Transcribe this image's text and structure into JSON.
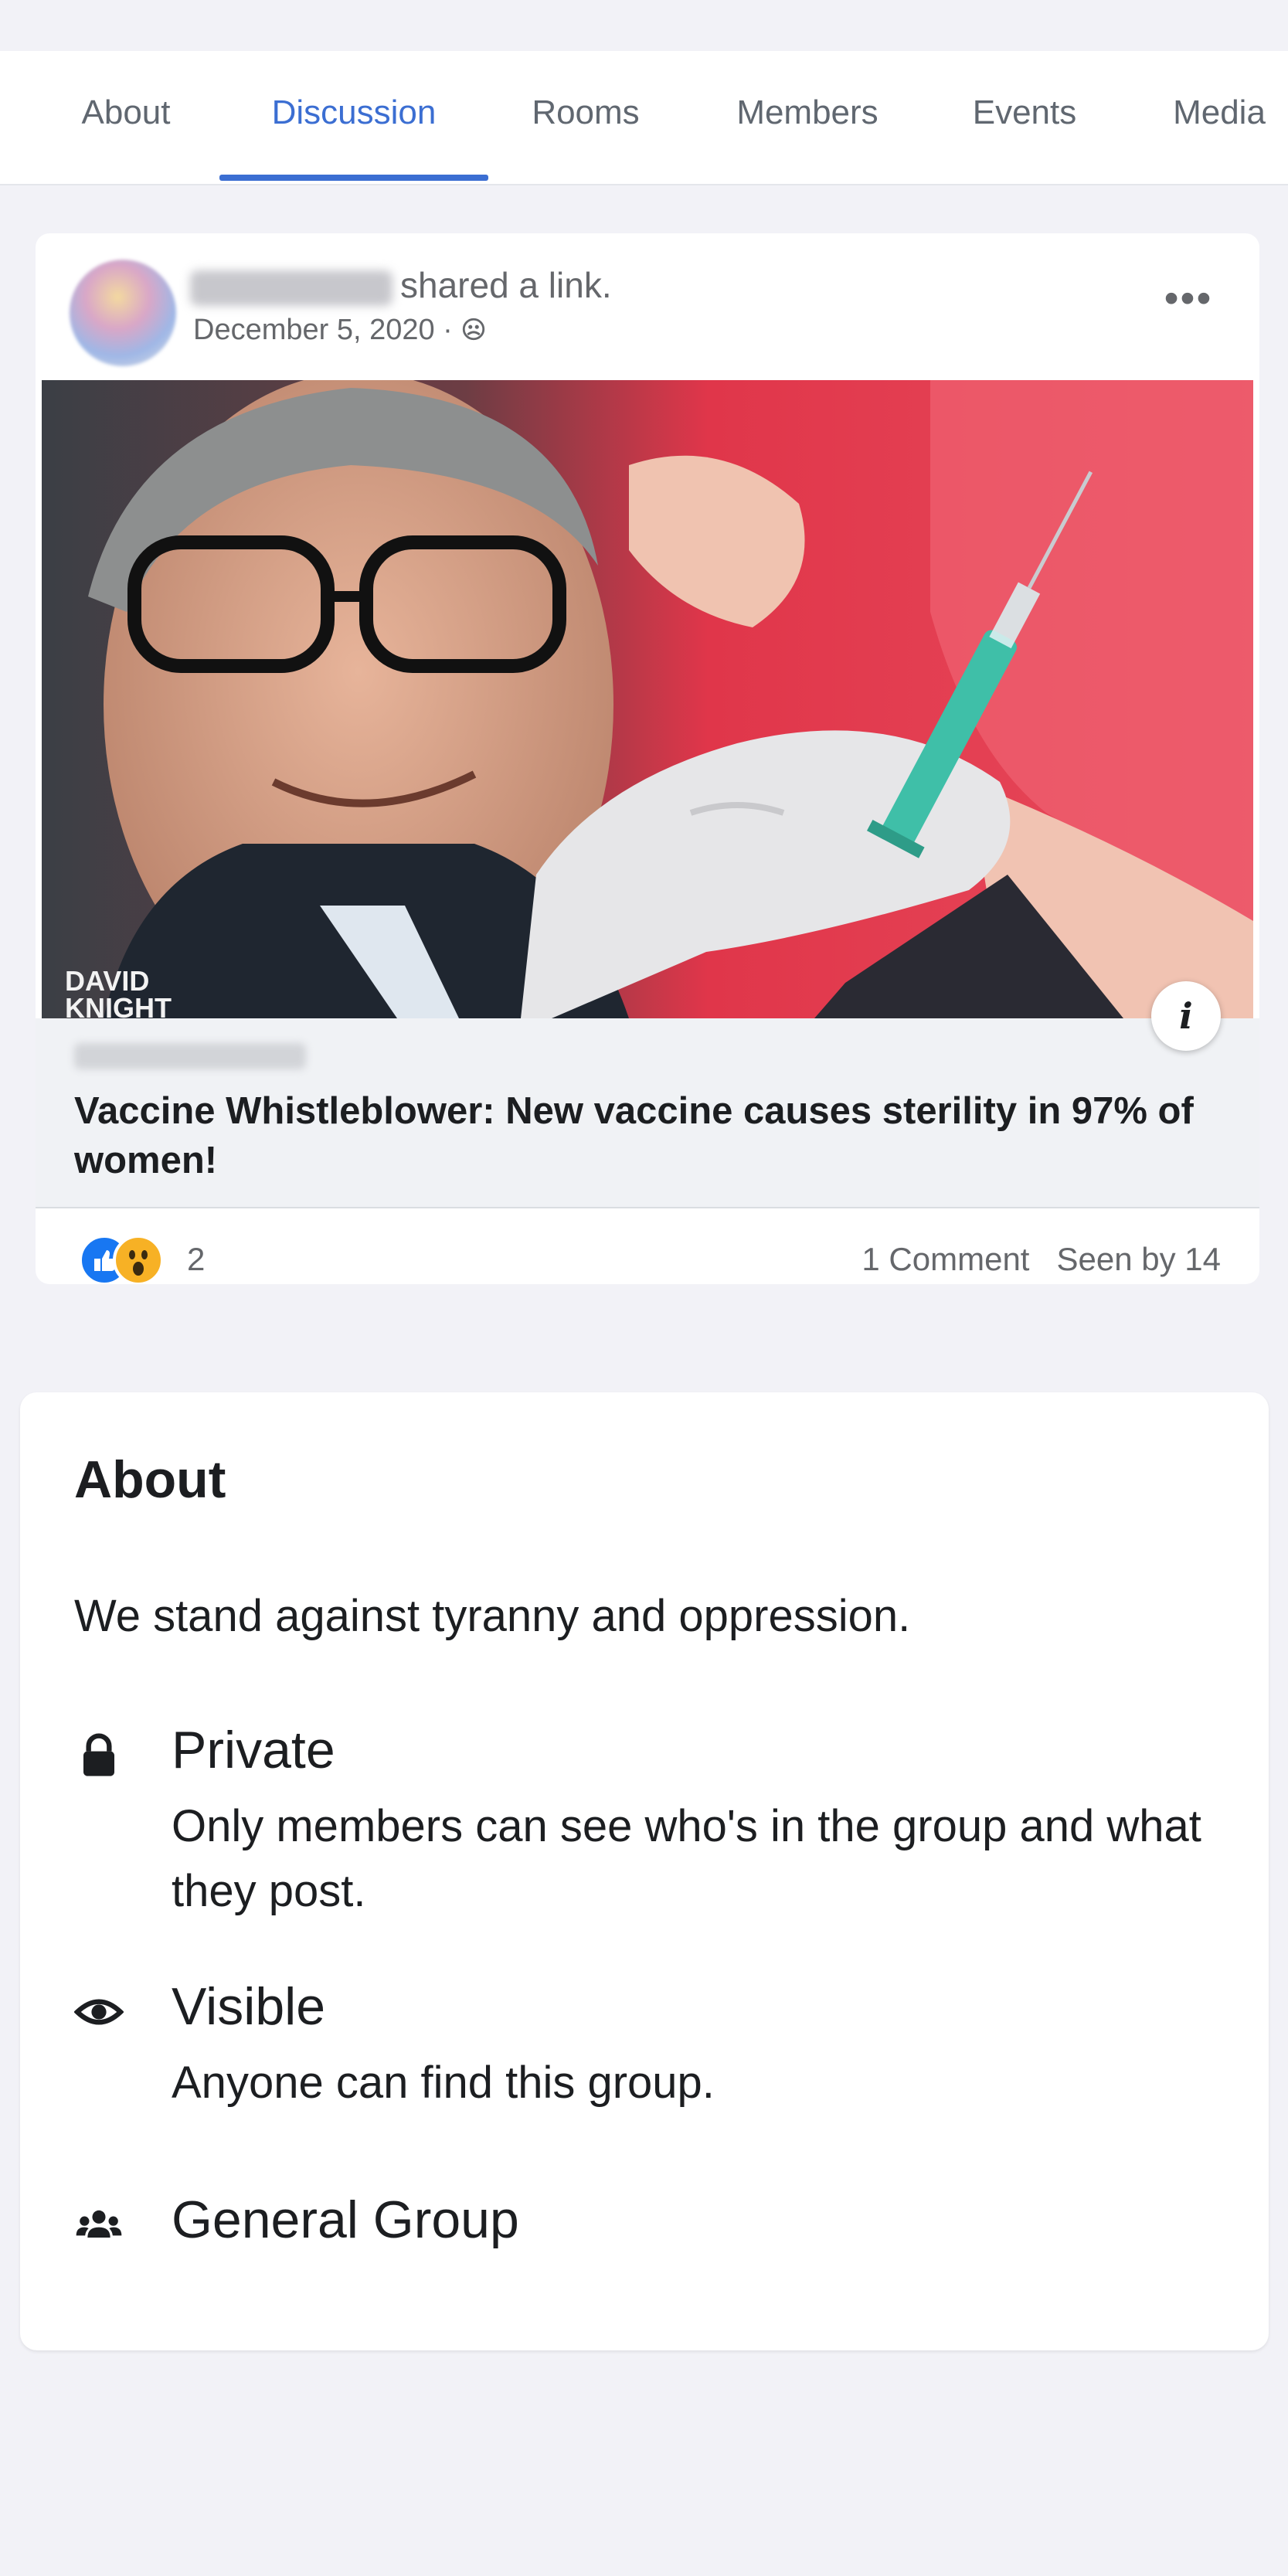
{
  "tabs": [
    {
      "label": "About"
    },
    {
      "label": "Discussion",
      "active": true
    },
    {
      "label": "Rooms"
    },
    {
      "label": "Members"
    },
    {
      "label": "Events"
    },
    {
      "label": "Media"
    }
  ],
  "post": {
    "action_text": "shared a link.",
    "date": "December 5, 2020 ·",
    "audience_icon": "members-icon",
    "more_label": "•••",
    "image_watermark": "DAVID KNIGHT",
    "link_title": "Vaccine Whistleblower: New vaccine causes sterility in 97% of women!",
    "info_label": "i",
    "reaction_count": "2",
    "comments_label": "1 Comment",
    "seen_label": "Seen by 14"
  },
  "about": {
    "heading": "About",
    "description": "We stand against tyranny and oppression.",
    "privacy": {
      "icon": "lock-icon",
      "title": "Private",
      "subtitle": "Only members can see who's in the group and what they post."
    },
    "visibility": {
      "icon": "eye-icon",
      "title": "Visible",
      "subtitle": "Anyone can find this group."
    },
    "group_type": {
      "icon": "people-icon",
      "title": "General Group"
    }
  },
  "colors": {
    "accent": "#3b6ed2",
    "background": "#f2f2f7",
    "like_blue": "#1877f2",
    "wow_yellow": "#f7b125"
  }
}
